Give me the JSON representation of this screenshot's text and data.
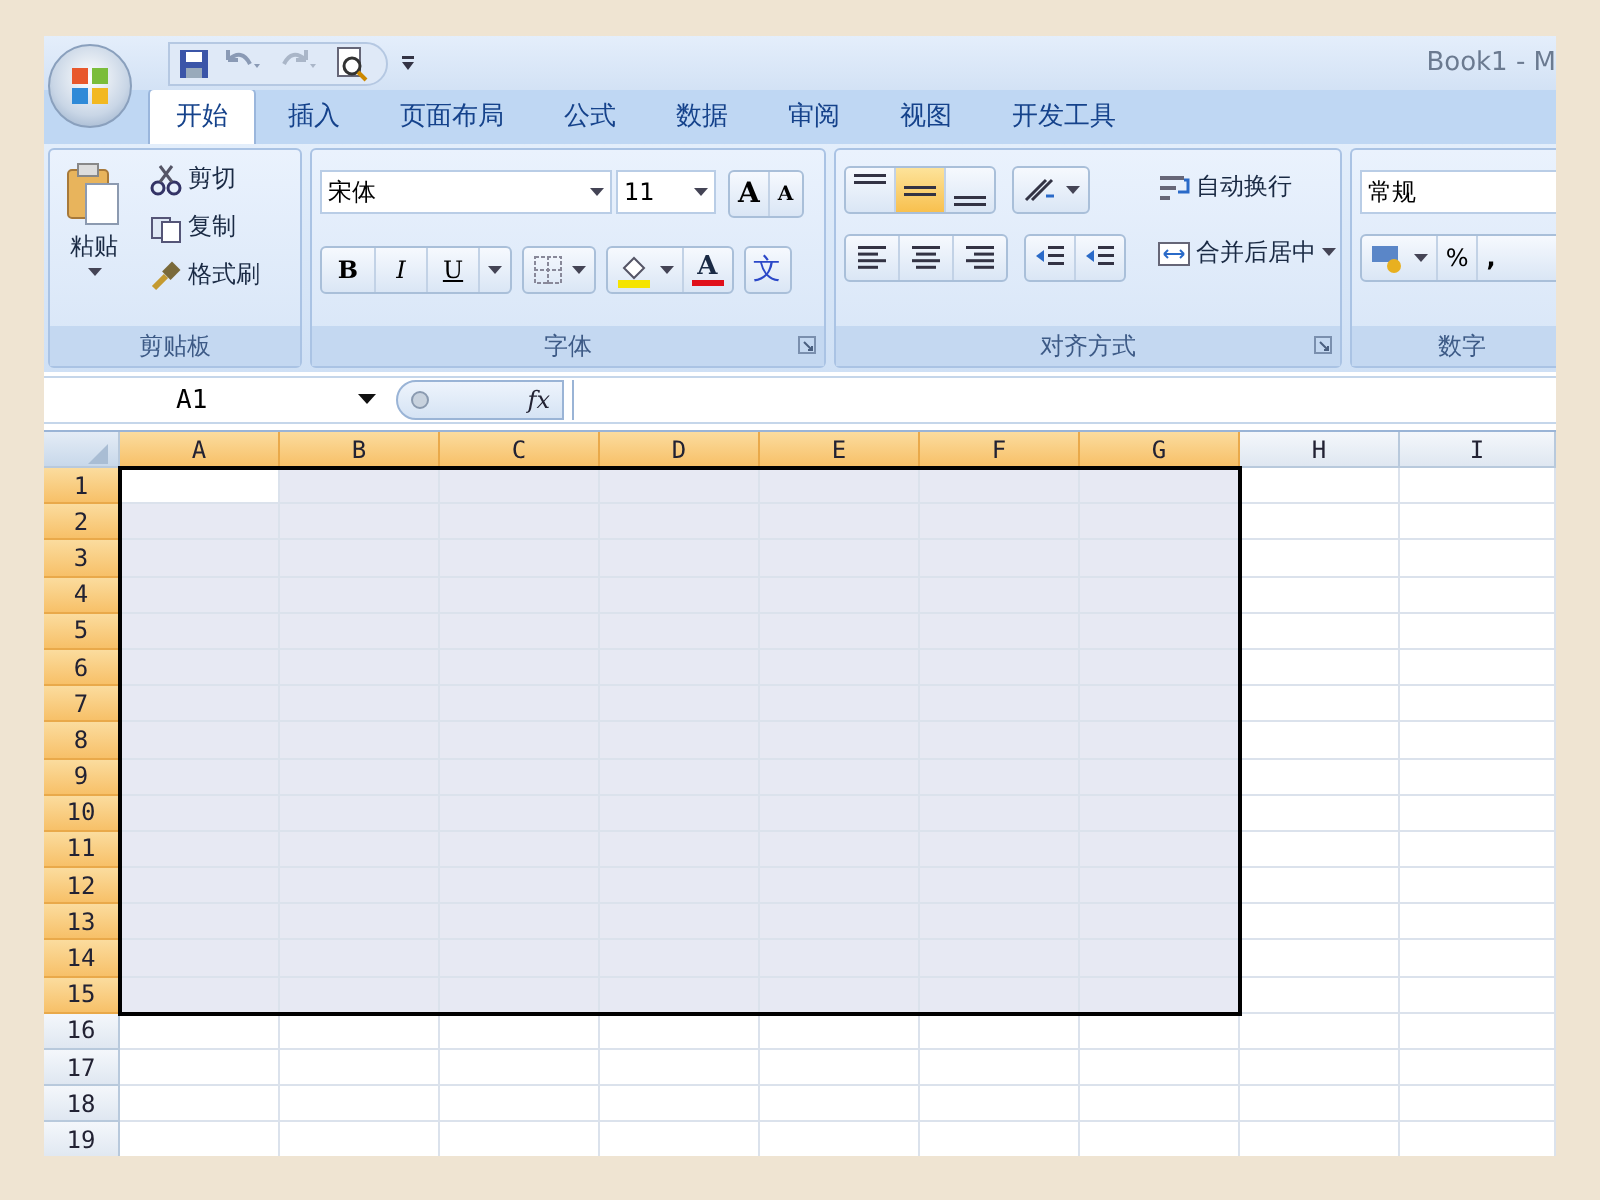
{
  "title_bar": {
    "title": "Book1 - M"
  },
  "tabs": [
    {
      "label": "开始",
      "selected": true
    },
    {
      "label": "插入",
      "selected": false
    },
    {
      "label": "页面布局",
      "selected": false
    },
    {
      "label": "公式",
      "selected": false
    },
    {
      "label": "数据",
      "selected": false
    },
    {
      "label": "审阅",
      "selected": false
    },
    {
      "label": "视图",
      "selected": false
    },
    {
      "label": "开发工具",
      "selected": false
    }
  ],
  "ribbon_groups": [
    {
      "kind": "clipboard",
      "name": "剪贴板",
      "paste": "粘贴",
      "items": [
        "剪切",
        "复制",
        "格式刷"
      ]
    },
    {
      "kind": "font",
      "name": "字体",
      "font": "宋体",
      "size": "11",
      "grow": "A",
      "shrink": "A",
      "styles": [
        "B",
        "I",
        "U"
      ],
      "font_color": "A",
      "phonetic": "文"
    },
    {
      "kind": "align",
      "name": "对齐方式",
      "vertical": [
        {
          "selected": false
        },
        {
          "selected": true
        },
        {
          "selected": false
        }
      ],
      "wrap": "自动换行",
      "merge": "合并后居中"
    },
    {
      "kind": "number",
      "name": "数字",
      "format": "常规",
      "percent": "%",
      "comma": ","
    }
  ],
  "formula_bar": {
    "name_box": "A1",
    "fx": "fx"
  },
  "sheet": {
    "columns": [
      {
        "label": "A",
        "selected": true
      },
      {
        "label": "B",
        "selected": true
      },
      {
        "label": "C",
        "selected": true
      },
      {
        "label": "D",
        "selected": true
      },
      {
        "label": "E",
        "selected": true
      },
      {
        "label": "F",
        "selected": true
      },
      {
        "label": "G",
        "selected": true
      },
      {
        "label": "H",
        "selected": false
      },
      {
        "label": "I",
        "selected": false
      }
    ],
    "rows": [
      {
        "label": "1",
        "selected": true
      },
      {
        "label": "2",
        "selected": true
      },
      {
        "label": "3",
        "selected": true
      },
      {
        "label": "4",
        "selected": true
      },
      {
        "label": "5",
        "selected": true
      },
      {
        "label": "6",
        "selected": true
      },
      {
        "label": "7",
        "selected": true
      },
      {
        "label": "8",
        "selected": true
      },
      {
        "label": "9",
        "selected": true
      },
      {
        "label": "10",
        "selected": true
      },
      {
        "label": "11",
        "selected": true
      },
      {
        "label": "12",
        "selected": true
      },
      {
        "label": "13",
        "selected": true
      },
      {
        "label": "14",
        "selected": true
      },
      {
        "label": "15",
        "selected": true
      },
      {
        "label": "16",
        "selected": false
      },
      {
        "label": "17",
        "selected": false
      },
      {
        "label": "18",
        "selected": false
      },
      {
        "label": "19",
        "selected": false
      }
    ]
  }
}
